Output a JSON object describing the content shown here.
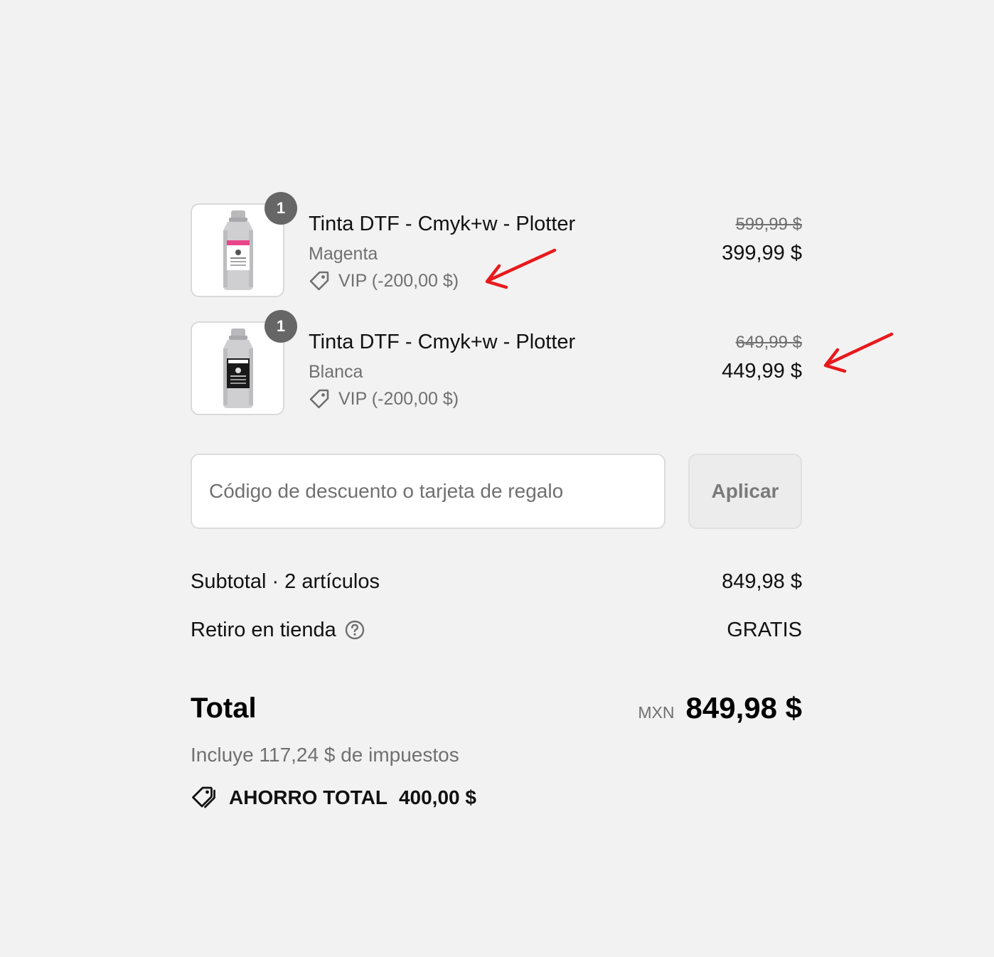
{
  "line_items": [
    {
      "quantity": "1",
      "title": "Tinta DTF - Cmyk+w - Plotter",
      "variant": "Magenta",
      "discount": "VIP (-200,00 $)",
      "price_original": "599,99 $",
      "price_final": "399,99 $",
      "label_color": "#e8468a"
    },
    {
      "quantity": "1",
      "title": "Tinta DTF - Cmyk+w - Plotter",
      "variant": "Blanca",
      "discount": "VIP (-200,00 $)",
      "price_original": "649,99 $",
      "price_final": "449,99 $",
      "label_color": "#1a1a1a"
    }
  ],
  "discount_code": {
    "placeholder": "Código de descuento o tarjeta de regalo",
    "value": "",
    "apply_label": "Aplicar"
  },
  "totals": {
    "subtotal_label": "Subtotal · 2 artículos",
    "subtotal_value": "849,98 $",
    "shipping_label": "Retiro en tienda",
    "shipping_value": "GRATIS",
    "total_label": "Total",
    "currency_code": "MXN",
    "total_value": "849,98 $",
    "tax_note": "Incluye 117,24 $ de impuestos",
    "savings_label": "AHORRO TOTAL",
    "savings_value": "400,00 $"
  },
  "colors": {
    "background": "#f2f2f2",
    "annotation_arrow": "#e8191c",
    "muted_text": "#707070",
    "badge": "#666666"
  },
  "icons": {
    "discount_tag": "tag-icon",
    "shipping_help": "question-circle-icon",
    "savings": "tags-icon",
    "annotation": "red-arrow-icon"
  }
}
